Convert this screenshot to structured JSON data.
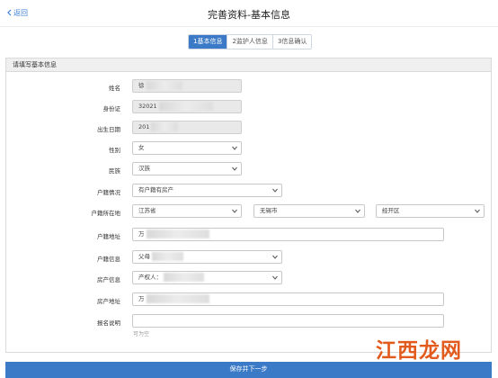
{
  "header": {
    "back_label": "返回",
    "title": "完善资料-基本信息"
  },
  "steps": [
    {
      "label": "1基本信息",
      "active": true
    },
    {
      "label": "2监护人信息",
      "active": false
    },
    {
      "label": "3信息确认",
      "active": false
    }
  ],
  "panel": {
    "title": "请填写基本信息"
  },
  "form": {
    "name": {
      "label": "姓名",
      "value": "徐"
    },
    "id_card": {
      "label": "身份证",
      "value": "32021"
    },
    "birth": {
      "label": "出生日期",
      "value": "201"
    },
    "gender": {
      "label": "性别",
      "value": "女"
    },
    "ethnicity": {
      "label": "民族",
      "value": "汉族"
    },
    "household_status": {
      "label": "户籍情况",
      "value": "有户籍有房产"
    },
    "household_location": {
      "label": "户籍所在地",
      "province": "江苏省",
      "city": "无锡市",
      "district": "经开区"
    },
    "household_address": {
      "label": "户籍地址",
      "value": "万"
    },
    "household_info": {
      "label": "户籍信息",
      "value": "父母"
    },
    "property_info": {
      "label": "房产信息",
      "value": "产权人："
    },
    "property_address": {
      "label": "房产地址",
      "value": "万"
    },
    "note": {
      "label": "报名说明",
      "value": "",
      "hint": "可为空"
    }
  },
  "buttons": {
    "save_label": "保存并下一步"
  },
  "watermark": {
    "text": "江西龙网"
  },
  "colors": {
    "accent": "#3a7ac6",
    "link": "#3b7fd6",
    "watermark": "#e25a1d"
  }
}
